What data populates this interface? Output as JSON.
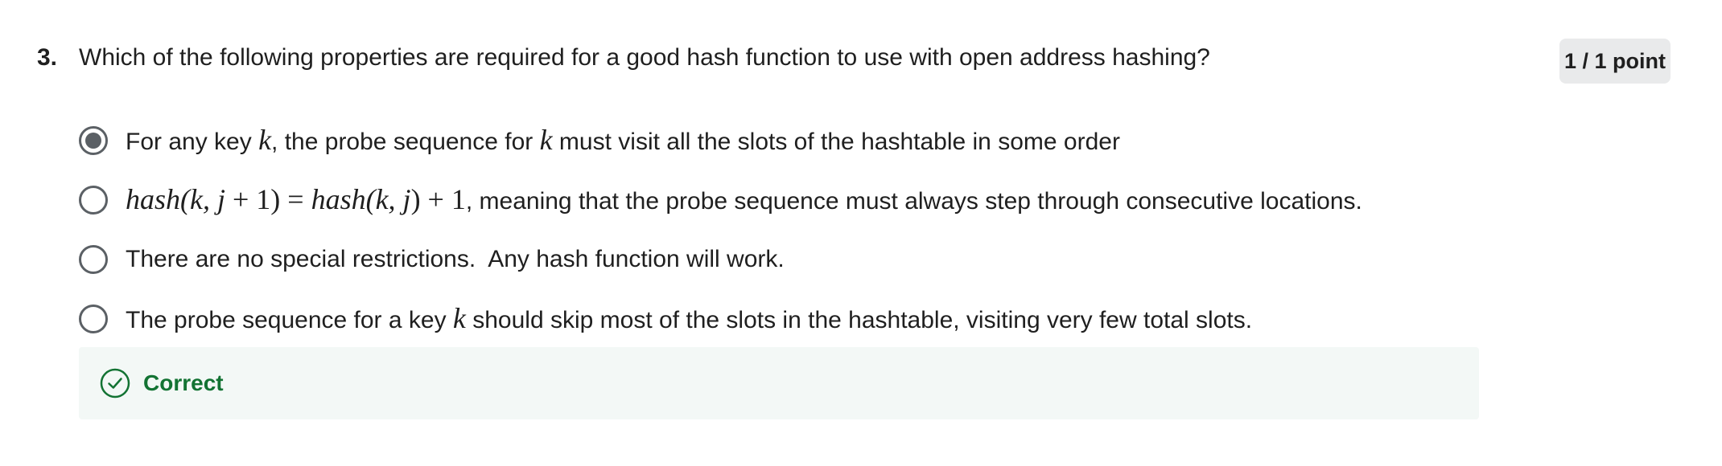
{
  "question": {
    "number": "3.",
    "text": "Which of the following properties are required for a good hash function to use with open address hashing?",
    "score": "1 / 1 point"
  },
  "options": [
    {
      "selected": true,
      "parts": {
        "a": "For any key ",
        "k1": "k",
        "b": ", the probe sequence for ",
        "k2": "k",
        "c": " must visit all the slots of the hashtable in some order"
      }
    },
    {
      "selected": false,
      "parts": {
        "f1": "hash(k, j",
        "f2": " + 1) = ",
        "f3": "hash(k, j",
        "f4": ") + 1",
        "rest": ", meaning that the probe sequence must always step through consecutive locations."
      }
    },
    {
      "selected": false,
      "text": "There are no special restrictions.  Any hash function will work."
    },
    {
      "selected": false,
      "parts": {
        "a": "The probe sequence for a key ",
        "k": "k",
        "b": " should skip most of the slots in the hashtable, visiting very few total slots."
      }
    }
  ],
  "feedback": {
    "icon": "check-circle-icon",
    "label": "Correct",
    "color": "#137333",
    "background": "#f3f8f6"
  }
}
